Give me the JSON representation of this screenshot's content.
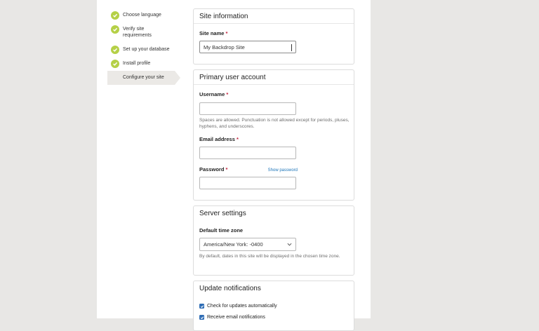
{
  "steps": [
    {
      "label": "Choose language",
      "done": true
    },
    {
      "label": "Verify site requirements",
      "done": true
    },
    {
      "label": "Set up your database",
      "done": true
    },
    {
      "label": "Install profile",
      "done": true
    },
    {
      "label": "Configure your site",
      "done": false,
      "active": true
    }
  ],
  "site_info": {
    "legend": "Site information",
    "site_name_label": "Site name",
    "required_mark": "*",
    "site_name_value": "My Backdrop Site"
  },
  "account": {
    "legend": "Primary user account",
    "username_label": "Username",
    "username_value": "",
    "username_desc": "Spaces are allowed. Punctuation is not allowed except for periods, pluses, hyphens, and underscores.",
    "email_label": "Email address",
    "email_value": "",
    "password_label": "Password",
    "show_password": "Show password",
    "password_value": ""
  },
  "server": {
    "legend": "Server settings",
    "tz_label": "Default time zone",
    "tz_value": "America/New York: -0400",
    "tz_desc": "By default, dates in this site will be displayed in the chosen time zone."
  },
  "updates": {
    "legend": "Update notifications",
    "check_updates_label": "Check for updates automatically",
    "check_updates_checked": true,
    "email_notify_label": "Receive email notifications",
    "email_notify_checked": true
  },
  "colors": {
    "check_green": "#b5d047",
    "checkbox_blue": "#2f6db5",
    "link_blue": "#1a73b8",
    "required_red": "#c41e3a"
  }
}
